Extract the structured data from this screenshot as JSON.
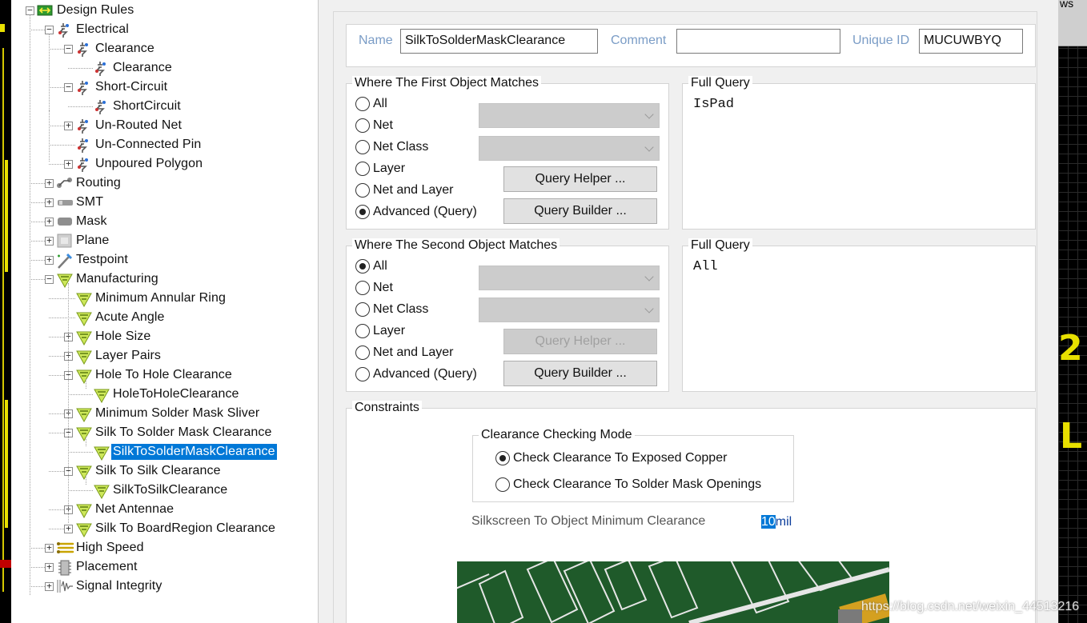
{
  "tree": {
    "items": [
      {
        "label": "Design Rules",
        "icon": "design-rules-icon"
      },
      {
        "label": "Electrical",
        "icon": "electrical-rule-icon"
      },
      {
        "label": "Clearance",
        "icon": "electrical-rule-icon"
      },
      {
        "label": "Clearance",
        "icon": "electrical-rule-icon"
      },
      {
        "label": "Short-Circuit",
        "icon": "electrical-rule-icon"
      },
      {
        "label": "ShortCircuit",
        "icon": "electrical-rule-icon"
      },
      {
        "label": "Un-Routed Net",
        "icon": "electrical-rule-icon"
      },
      {
        "label": "Un-Connected Pin",
        "icon": "electrical-rule-icon"
      },
      {
        "label": "Unpoured Polygon",
        "icon": "electrical-rule-icon"
      },
      {
        "label": "Routing",
        "icon": "routing-icon"
      },
      {
        "label": "SMT",
        "icon": "smt-icon"
      },
      {
        "label": "Mask",
        "icon": "mask-icon"
      },
      {
        "label": "Plane",
        "icon": "plane-icon"
      },
      {
        "label": "Testpoint",
        "icon": "testpoint-icon"
      },
      {
        "label": "Manufacturing",
        "icon": "manufacturing-icon"
      },
      {
        "label": "Minimum Annular Ring",
        "icon": "manufacturing-icon"
      },
      {
        "label": "Acute Angle",
        "icon": "manufacturing-icon"
      },
      {
        "label": "Hole Size",
        "icon": "manufacturing-icon"
      },
      {
        "label": "Layer Pairs",
        "icon": "manufacturing-icon"
      },
      {
        "label": "Hole To Hole Clearance",
        "icon": "manufacturing-icon"
      },
      {
        "label": "HoleToHoleClearance",
        "icon": "manufacturing-icon"
      },
      {
        "label": "Minimum Solder Mask Sliver",
        "icon": "manufacturing-icon"
      },
      {
        "label": "Silk To Solder Mask Clearance",
        "icon": "manufacturing-icon"
      },
      {
        "label": "SilkToSolderMaskClearance",
        "icon": "manufacturing-icon"
      },
      {
        "label": "Silk To Silk Clearance",
        "icon": "manufacturing-icon"
      },
      {
        "label": "SilkToSilkClearance",
        "icon": "manufacturing-icon"
      },
      {
        "label": "Net Antennae",
        "icon": "manufacturing-icon"
      },
      {
        "label": "Silk To BoardRegion Clearance",
        "icon": "manufacturing-icon"
      },
      {
        "label": "High Speed",
        "icon": "high-speed-icon"
      },
      {
        "label": "Placement",
        "icon": "placement-icon"
      },
      {
        "label": "Signal Integrity",
        "icon": "signal-integrity-icon"
      }
    ],
    "selected": "SilkToSolderMaskClearance"
  },
  "header": {
    "name_label": "Name",
    "name_value": "SilkToSolderMaskClearance",
    "comment_label": "Comment",
    "comment_value": "",
    "uid_label": "Unique ID",
    "uid_value": "MUCUWBYQ"
  },
  "first": {
    "title": "Where The First Object Matches",
    "options": [
      "All",
      "Net",
      "Net Class",
      "Layer",
      "Net and Layer",
      "Advanced (Query)"
    ],
    "selected": "Advanced (Query)",
    "helper_label": "Query Helper ...",
    "builder_label": "Query Builder ...",
    "full_query_title": "Full Query",
    "full_query": "IsPad"
  },
  "second": {
    "title": "Where The Second Object Matches",
    "options": [
      "All",
      "Net",
      "Net Class",
      "Layer",
      "Net and Layer",
      "Advanced (Query)"
    ],
    "selected": "All",
    "helper_label": "Query Helper ...",
    "builder_label": "Query Builder ...",
    "full_query_title": "Full Query",
    "full_query": "All"
  },
  "constraints": {
    "title": "Constraints",
    "mode_title": "Clearance Checking Mode",
    "mode_options": [
      "Check Clearance To Exposed Copper",
      "Check Clearance To Solder Mask Openings"
    ],
    "mode_selected": "Check Clearance To Exposed Copper",
    "min_label": "Silkscreen To Object Minimum Clearance",
    "min_value": "10",
    "min_unit": "mil"
  },
  "pcb": {
    "top_text": "ws",
    "glyph_2": "2",
    "glyph_l": "L"
  },
  "watermark": "https://blog.csdn.net/weixin_44513216",
  "colors": {
    "selection": "#0078d7",
    "label_blue": "#7a9cc6",
    "pcb_yellow": "#e8e000",
    "preview_green": "#1f5a2a"
  }
}
